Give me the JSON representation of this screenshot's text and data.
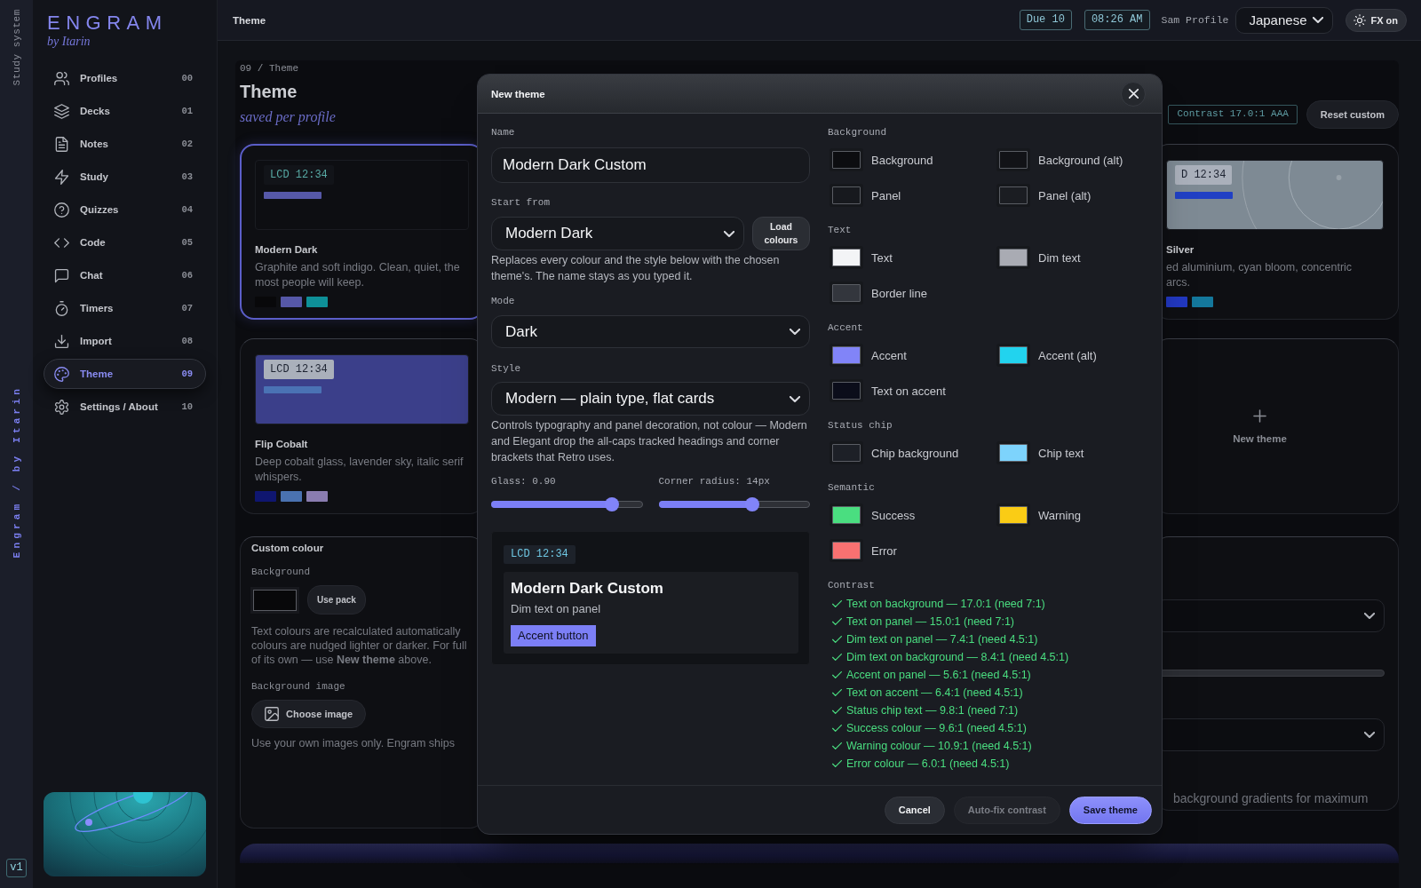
{
  "rail": {
    "top_label": "Study system",
    "bottom_label": "Engram / by Itarin",
    "version": "v1"
  },
  "sidebar": {
    "logo": "ENGRAM",
    "byline": "by Itarin",
    "items": [
      {
        "label": "Profiles",
        "number": "00",
        "selected": false
      },
      {
        "label": "Decks",
        "number": "01",
        "selected": false
      },
      {
        "label": "Notes",
        "number": "02",
        "selected": false
      },
      {
        "label": "Study",
        "number": "03",
        "selected": false
      },
      {
        "label": "Quizzes",
        "number": "04",
        "selected": false
      },
      {
        "label": "Code",
        "number": "05",
        "selected": false
      },
      {
        "label": "Chat",
        "number": "06",
        "selected": false
      },
      {
        "label": "Timers",
        "number": "07",
        "selected": false
      },
      {
        "label": "Import",
        "number": "08",
        "selected": false
      },
      {
        "label": "Theme",
        "number": "09",
        "selected": true
      },
      {
        "label": "Settings / About",
        "number": "10",
        "selected": false
      }
    ]
  },
  "topbar": {
    "title": "Theme",
    "due": "Due 10",
    "time": "08:26 AM",
    "profile": "Sam Profile",
    "language": "Japanese",
    "fx_button": "FX on"
  },
  "page": {
    "breadcrumb": "09 / Theme",
    "title": "Theme",
    "subtitle": "saved per profile",
    "contrast": "Contrast 17.0:1 AAA",
    "reset_button": "Reset custom"
  },
  "theme_cards_left": [
    {
      "kind": "theme",
      "name": "Modern Dark",
      "selected": true,
      "preview": {
        "color": "#0d0e12",
        "light_chip": false,
        "chip": "LCD 12:34",
        "bar": {
          "color": "#5658a8"
        },
        "arcs": false
      },
      "description": [
        "Graphite and soft indigo. Clean, quiet, the",
        "most people will keep."
      ],
      "swatches": [
        {
          "color": "#08080a"
        },
        {
          "color": "#5658a8"
        },
        {
          "color": "#0e9098"
        }
      ]
    },
    {
      "kind": "theme",
      "name": "Flip Cobalt",
      "selected": false,
      "preview": {
        "color": "#3b3f8a",
        "light_chip": true,
        "chip": "LCD 12:34",
        "bar": {
          "color": "#4a72b4"
        },
        "arcs": false
      },
      "description": [
        "Deep cobalt glass, lavender sky, italic serif",
        "whispers."
      ],
      "swatches": [
        {
          "color": "#0f1670"
        },
        {
          "color": "#4a72b0"
        },
        {
          "color": "#8a7cb0"
        }
      ]
    }
  ],
  "theme_cards_right": [
    {
      "kind": "theme",
      "name": "Silver",
      "selected": false,
      "preview": {
        "color": "#7e8a94",
        "light_chip": true,
        "chip": "D 12:34",
        "bar": {
          "color": "#2140c4"
        },
        "arcs": true
      },
      "description": [
        "ed aluminium, cyan bloom, concentric",
        "arcs."
      ],
      "swatches": [
        {
          "color": "#2238c0"
        },
        {
          "color": "#14789c"
        }
      ]
    },
    {
      "kind": "add",
      "label": "New theme"
    }
  ],
  "custom_colour": {
    "title": "Custom colour",
    "background_label": "Background",
    "use_button": "Use pack",
    "note_lines": [
      "Text colours are recalculated automatically",
      "colours are nudged lighter or darker. For full",
      "of its own — use **New theme** above."
    ],
    "image_label": "Background image",
    "image_button": "Choose image",
    "image_note": "Use your own images only. Engram ships"
  },
  "side_panel": {
    "controls": [
      {
        "kind": "select"
      },
      {
        "kind": "slider"
      },
      {
        "kind": "select"
      }
    ],
    "note": "background gradients for maximum"
  },
  "dialog": {
    "title": "New theme",
    "name": {
      "label": "Name",
      "value": "Modern Dark Custom"
    },
    "start_from": {
      "label": "Start from",
      "value": "Modern Dark",
      "button": "Load colours",
      "help": "Replaces every colour and the style below with the chosen theme's. The name stays as you typed it."
    },
    "mode": {
      "label": "Mode",
      "value": "Dark"
    },
    "style": {
      "label": "Style",
      "value": "Modern — plain type, flat cards",
      "help": "Controls typography and panel decoration, not colour — Modern and Elegant drop the all-caps tracked headings and corner brackets that Retro uses."
    },
    "sliders": [
      {
        "label": "Glass: 0.90",
        "level": 0.8
      },
      {
        "label": "Corner radius: 14px",
        "level": 0.62
      }
    ],
    "preview": {
      "chip": "LCD 12:34",
      "title": "Modern Dark Custom",
      "dim_text": "Dim text on panel",
      "button": "Accent button"
    },
    "colour_groups": [
      {
        "title": "Background",
        "items": [
          {
            "label": "Background",
            "color": "#0c0d10"
          },
          {
            "label": "Background (alt)",
            "color": "#121317"
          },
          {
            "label": "Panel",
            "color": "#17191e"
          },
          {
            "label": "Panel (alt)",
            "color": "#1b1d22"
          }
        ]
      },
      {
        "title": "Text",
        "items": [
          {
            "label": "Text",
            "color": "#f3f4f6"
          },
          {
            "label": "Dim text",
            "color": "#a9abb3"
          },
          {
            "label": "Border line",
            "color": "#33363d"
          }
        ]
      },
      {
        "title": "Accent",
        "items": [
          {
            "label": "Accent",
            "color": "#8184f8"
          },
          {
            "label": "Accent (alt)",
            "color": "#22d3ee"
          },
          {
            "label": "Text on accent",
            "color": "#0b0d1a"
          }
        ]
      },
      {
        "title": "Status chip",
        "items": [
          {
            "label": "Chip background",
            "color": "#1d2027"
          },
          {
            "label": "Chip text",
            "color": "#7dd3fc"
          }
        ]
      },
      {
        "title": "Semantic",
        "items": [
          {
            "label": "Success",
            "color": "#4ade80"
          },
          {
            "label": "Warning",
            "color": "#facc15"
          },
          {
            "label": "Error",
            "color": "#f87171"
          }
        ]
      }
    ],
    "contrast": {
      "title": "Contrast",
      "checks": [
        {
          "text": "Text on background — 17.0:1 (need 7:1)",
          "pass": true
        },
        {
          "text": "Text on panel — 15.0:1 (need 7:1)",
          "pass": true
        },
        {
          "text": "Dim text on panel — 7.4:1 (need 4.5:1)",
          "pass": true
        },
        {
          "text": "Dim text on background — 8.4:1 (need 4.5:1)",
          "pass": true
        },
        {
          "text": "Accent on panel — 5.6:1 (need 4.5:1)",
          "pass": true
        },
        {
          "text": "Text on accent — 6.4:1 (need 4.5:1)",
          "pass": true
        },
        {
          "text": "Status chip text — 9.8:1 (need 7:1)",
          "pass": true
        },
        {
          "text": "Success colour — 9.6:1 (need 4.5:1)",
          "pass": true
        },
        {
          "text": "Warning colour — 10.9:1 (need 4.5:1)",
          "pass": true
        },
        {
          "text": "Error colour — 6.0:1 (need 4.5:1)",
          "pass": true
        }
      ]
    },
    "buttons": [
      {
        "kind": "secondary",
        "label": "Cancel",
        "disabled": false
      },
      {
        "kind": "secondary",
        "label": "Auto-fix contrast",
        "disabled": true
      },
      {
        "kind": "primary",
        "label": "Save theme",
        "disabled": false
      }
    ]
  }
}
